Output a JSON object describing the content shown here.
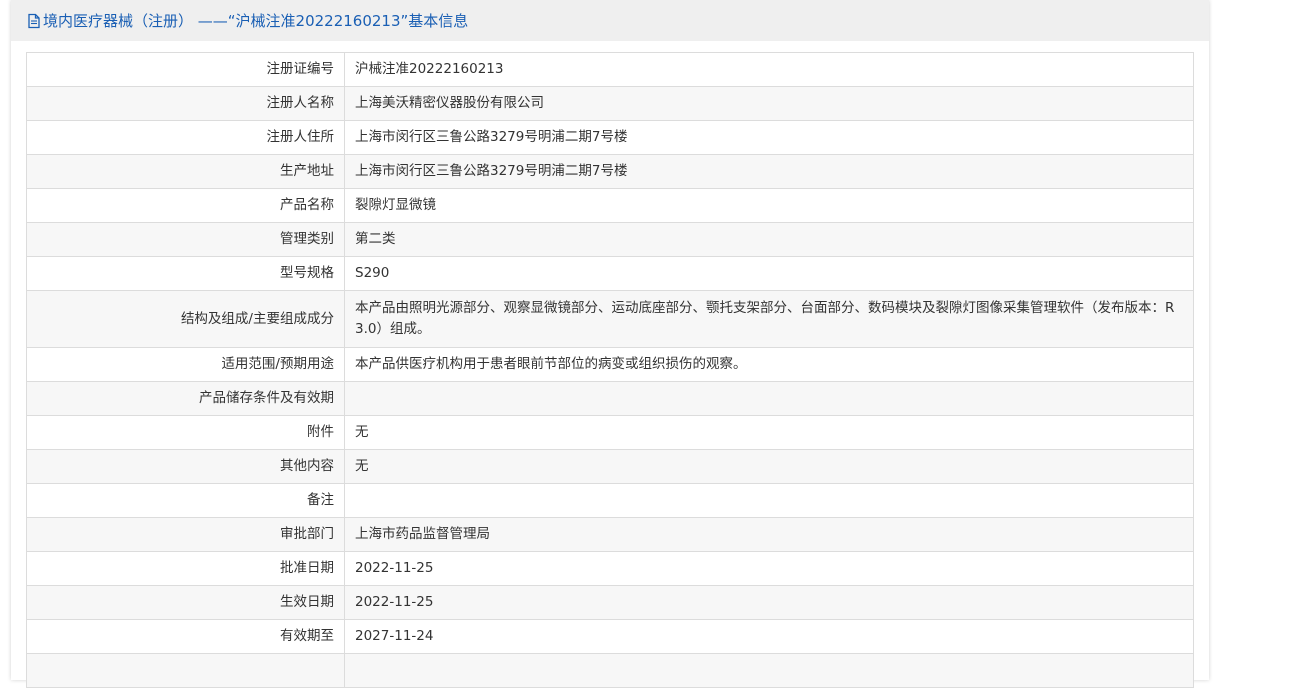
{
  "header": {
    "title": "境内医疗器械（注册） ——“沪械注准20222160213”基本信息",
    "icon": "document-icon",
    "title_color": "#1a5fb4"
  },
  "rows": [
    {
      "label": "注册证编号",
      "value": "沪械注准20222160213"
    },
    {
      "label": "注册人名称",
      "value": "上海美沃精密仪器股份有限公司"
    },
    {
      "label": "注册人住所",
      "value": "上海市闵行区三鲁公路3279号明浦二期7号楼"
    },
    {
      "label": "生产地址",
      "value": "上海市闵行区三鲁公路3279号明浦二期7号楼"
    },
    {
      "label": "产品名称",
      "value": "裂隙灯显微镜"
    },
    {
      "label": "管理类别",
      "value": "第二类"
    },
    {
      "label": "型号规格",
      "value": "S290"
    },
    {
      "label": "结构及组成/主要组成成分",
      "value": "本产品由照明光源部分、观察显微镜部分、运动底座部分、颚托支架部分、台面部分、数码模块及裂隙灯图像采集管理软件（发布版本：R3.0）组成。"
    },
    {
      "label": "适用范围/预期用途",
      "value": "本产品供医疗机构用于患者眼前节部位的病变或组织损伤的观察。"
    },
    {
      "label": "产品储存条件及有效期",
      "value": ""
    },
    {
      "label": "附件",
      "value": "无"
    },
    {
      "label": "其他内容",
      "value": "无"
    },
    {
      "label": "备注",
      "value": ""
    },
    {
      "label": "审批部门",
      "value": "上海市药品监督管理局"
    },
    {
      "label": "批准日期",
      "value": "2022-11-25"
    },
    {
      "label": "生效日期",
      "value": "2022-11-25"
    },
    {
      "label": "有效期至",
      "value": "2027-11-24"
    },
    {
      "label": "",
      "value": ""
    }
  ]
}
